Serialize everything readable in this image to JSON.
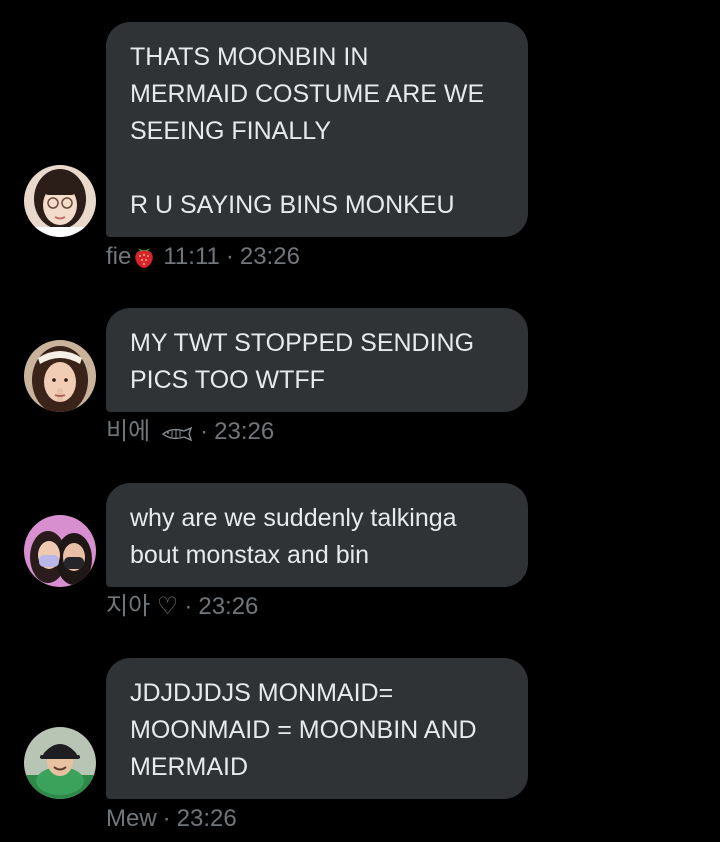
{
  "messages": [
    {
      "text": "THATS MOONBIN IN\nMERMAID COSTUME ARE WE\nSEEING FINALLY\n\nR U SAYING BINS MONKEU",
      "sender": "fie",
      "sender_emoji": "strawberry-icon",
      "sender_suffix": "11:11",
      "time": "23:26"
    },
    {
      "text": "MY TWT STOPPED SENDING\nPICS TOO WTFF",
      "sender": "비에",
      "sender_emoji": "fish-icon",
      "sender_suffix": "",
      "time": "23:26"
    },
    {
      "text": "why are we suddenly talkinga\nbout monstax and bin",
      "sender": "지아 ♡",
      "sender_emoji": "",
      "sender_suffix": "",
      "time": "23:26"
    },
    {
      "text": "JDJDJDJS MONMAID=\nMOONMAID = MOONBIN AND\nMERMAID",
      "sender": "Mew",
      "sender_emoji": "",
      "sender_suffix": "",
      "time": "23:26"
    }
  ],
  "separator": "·",
  "colors": {
    "background": "#000000",
    "bubble": "#2f3336",
    "text": "#e7e9ea",
    "meta": "#71767b"
  }
}
